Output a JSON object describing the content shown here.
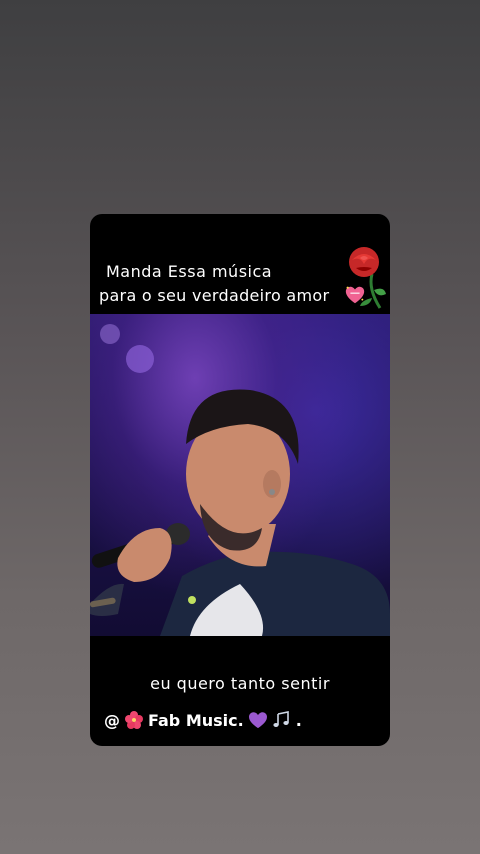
{
  "story": {
    "caption_line1": "Manda Essa música",
    "caption_line2": "para o seu verdadeiro amor",
    "subtitle": "eu quero tanto sentir",
    "handle_prefix": "@",
    "handle_name": "Fab Music.",
    "handle_suffix": "."
  },
  "icons": {
    "rose": "rose-icon",
    "heart": "sparkling-heart-icon",
    "flower": "hibiscus-icon",
    "purple_heart": "purple-heart-icon",
    "notes": "music-notes-icon"
  },
  "colors": {
    "background_top": "#3f3f41",
    "background_bottom": "#7a7474",
    "card": "#000000",
    "stage_purple": "#6e3fb3"
  }
}
